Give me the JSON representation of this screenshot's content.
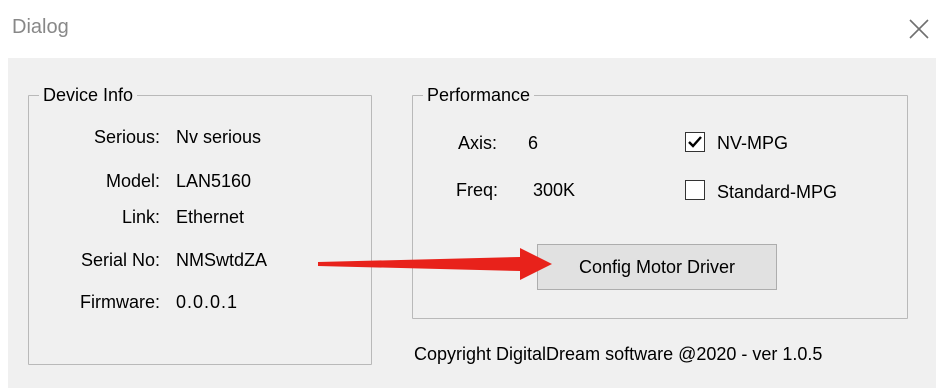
{
  "window": {
    "title": "Dialog",
    "close_icon": "close-icon"
  },
  "device_info": {
    "legend": "Device Info",
    "rows": [
      {
        "label": "Serious:",
        "value": "Nv serious"
      },
      {
        "label": "Model:",
        "value": "LAN5160"
      },
      {
        "label": "Link:",
        "value": "Ethernet"
      },
      {
        "label": "Serial No:",
        "value": "NMSwtdZA"
      },
      {
        "label": "Firmware:",
        "value": "0.0.0.1"
      }
    ]
  },
  "performance": {
    "legend": "Performance",
    "axis_label": "Axis:",
    "axis_value": "6",
    "freq_label": "Freq:",
    "freq_value": "300K",
    "nv_mpg": {
      "label": "NV-MPG",
      "checked": true
    },
    "standard_mpg": {
      "label": "Standard-MPG",
      "checked": false
    },
    "config_button": "Config Motor Driver"
  },
  "footer": {
    "copyright": "Copyright DigitalDream software @2020 - ver 1.0.5"
  },
  "annotation": {
    "arrow_color": "#e8221b"
  }
}
